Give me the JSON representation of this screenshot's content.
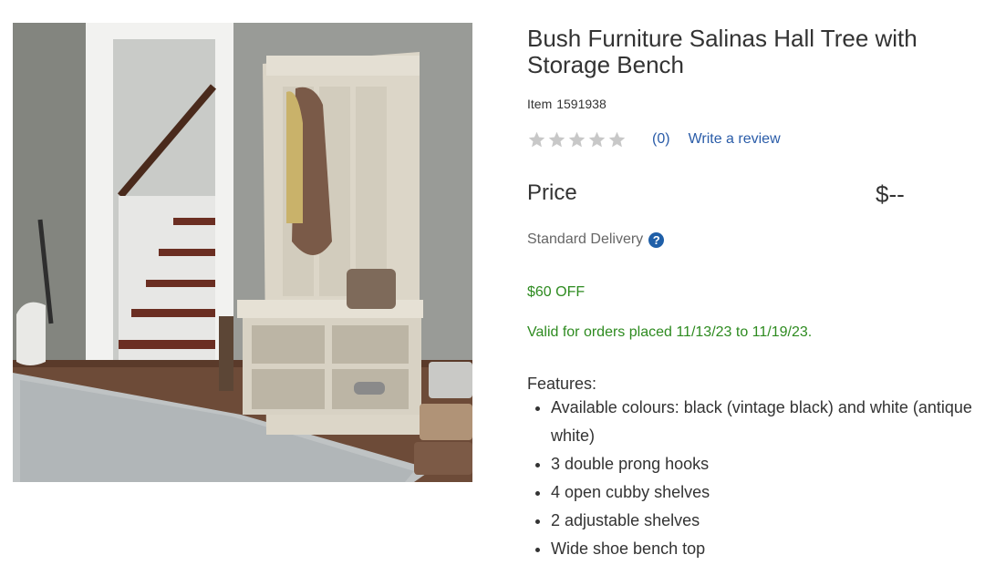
{
  "product": {
    "title": "Bush Furniture Salinas Hall Tree with Storage Bench",
    "item_label": "Item",
    "item_number": "1591938",
    "rating_stars": 0,
    "review_count": "(0)",
    "write_review": "Write a review",
    "price_label": "Price",
    "price_value": "$--",
    "delivery_label": "Standard Delivery",
    "help_icon": "?",
    "promo_title": "$60 OFF",
    "promo_valid": "Valid for orders placed 11/13/23 to 11/19/23.",
    "features_heading": "Features:",
    "features": [
      "Available colours: black (vintage black) and white (antique white)",
      "3 double prong hooks",
      "4 open cubby shelves",
      "2 adjustable shelves",
      "Wide shoe bench top"
    ]
  },
  "colors": {
    "link": "#2a5ca8",
    "promo": "#2e8b20",
    "star_empty": "#c8c8c8",
    "help_icon_bg": "#1f5fa8"
  }
}
